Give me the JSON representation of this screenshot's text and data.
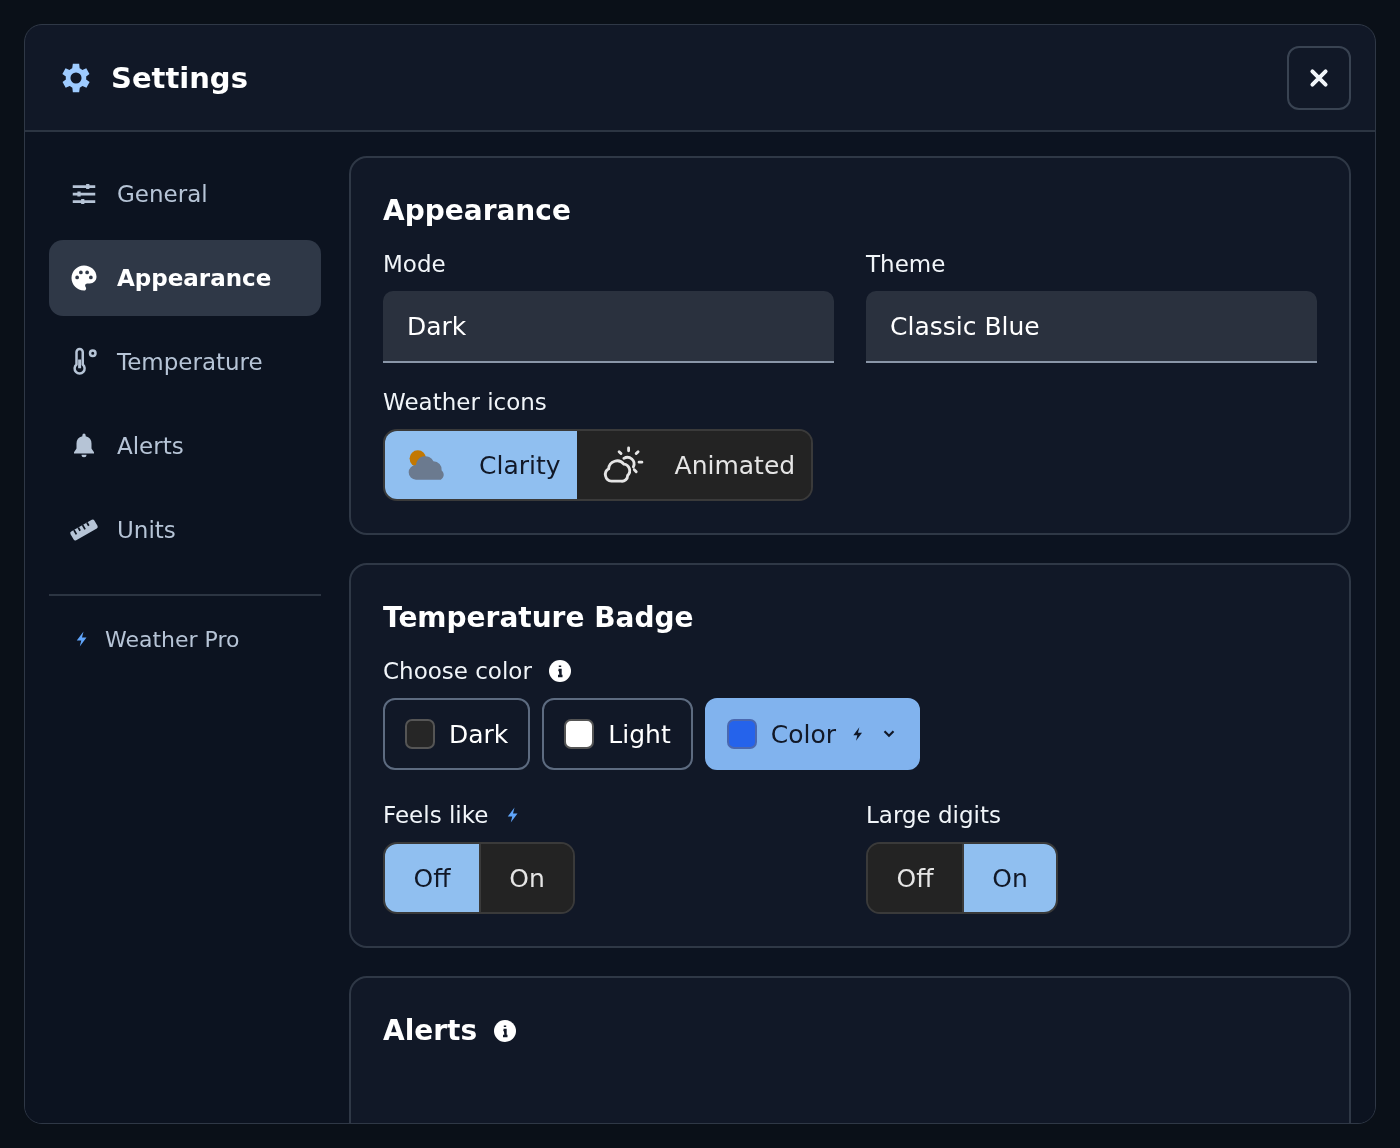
{
  "dialog": {
    "title": "Settings"
  },
  "sidebar": {
    "items": [
      {
        "label": "General",
        "selected": false
      },
      {
        "label": "Appearance",
        "selected": true
      },
      {
        "label": "Temperature",
        "selected": false
      },
      {
        "label": "Alerts",
        "selected": false
      },
      {
        "label": "Units",
        "selected": false
      }
    ],
    "footer": {
      "label": "Weather Pro"
    }
  },
  "appearance": {
    "title": "Appearance",
    "fields": [
      {
        "label": "Mode",
        "value": "Dark"
      },
      {
        "label": "Theme",
        "value": "Classic Blue"
      }
    ],
    "weather_icons": {
      "label": "Weather icons",
      "options": [
        {
          "label": "Clarity",
          "selected": true
        },
        {
          "label": "Animated",
          "selected": false
        }
      ]
    }
  },
  "temperature_badge": {
    "title": "Temperature Badge",
    "choose_color": {
      "label": "Choose color",
      "options": [
        {
          "label": "Dark",
          "color": "#262626",
          "selected": false,
          "pro": false,
          "dropdown": false
        },
        {
          "label": "Light",
          "color": "#ffffff",
          "selected": false,
          "pro": false,
          "dropdown": false
        },
        {
          "label": "Color",
          "color": "#2563eb",
          "selected": true,
          "pro": true,
          "dropdown": true
        }
      ]
    },
    "toggles": [
      {
        "label": "Feels like",
        "pro": true,
        "options": [
          {
            "label": "Off",
            "selected": true
          },
          {
            "label": "On",
            "selected": false
          }
        ]
      },
      {
        "label": "Large digits",
        "pro": false,
        "options": [
          {
            "label": "Off",
            "selected": false
          },
          {
            "label": "On",
            "selected": true
          }
        ]
      }
    ]
  },
  "alerts": {
    "title": "Alerts"
  }
}
